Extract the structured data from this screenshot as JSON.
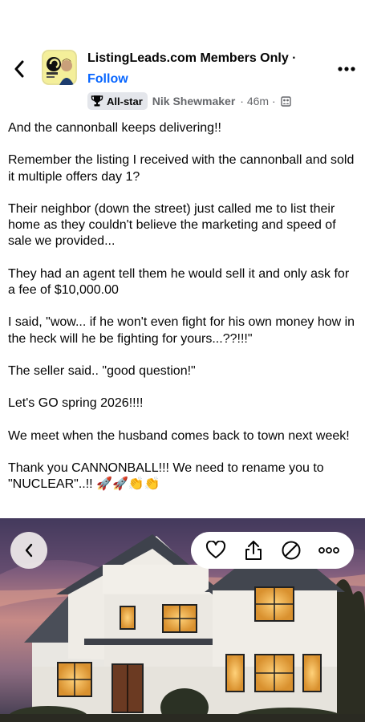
{
  "header": {
    "group_name": "ListingLeads.com Members Only ·",
    "follow_label": "Follow",
    "back_icon": "chevron-left-icon",
    "more_icon": "more-dots-icon"
  },
  "meta": {
    "badge_label": "All-star",
    "badge_icon": "trophy-icon",
    "author": "Nik Shewmaker",
    "time": "· 46m ·",
    "audience_icon": "group-audience-icon"
  },
  "post": {
    "paragraphs": [
      "And the cannonball keeps delivering!!",
      "Remember the listing I received with the cannonball and sold it multiple offers day 1?",
      "Their neighbor (down the street) just called me to list their home as they couldn't believe the marketing and speed of sale we provided...",
      "They had an agent tell them he would sell it and only ask for a fee of $10,000.00",
      "I said, \"wow... if he won't even fight for his own money how in the heck will he be fighting for yours...??!!!\"",
      "The seller said.. \"good question!\"",
      "Let's GO spring 2026!!!!",
      "We meet when the husband comes back to town next week!",
      "Thank you CANNONBALL!!! We need to rename you to \"NUCLEAR\"..!! 🚀🚀👏👏"
    ]
  },
  "photo": {
    "subject": "two-story house at dusk",
    "back_icon": "chevron-left-icon",
    "actions": [
      "heart-icon",
      "share-icon",
      "block-icon",
      "more-dots-icon"
    ]
  },
  "colors": {
    "accent": "#0866ff",
    "text": "#050505",
    "secondary_text": "#65676b",
    "badge_bg": "#e4e6eb"
  }
}
